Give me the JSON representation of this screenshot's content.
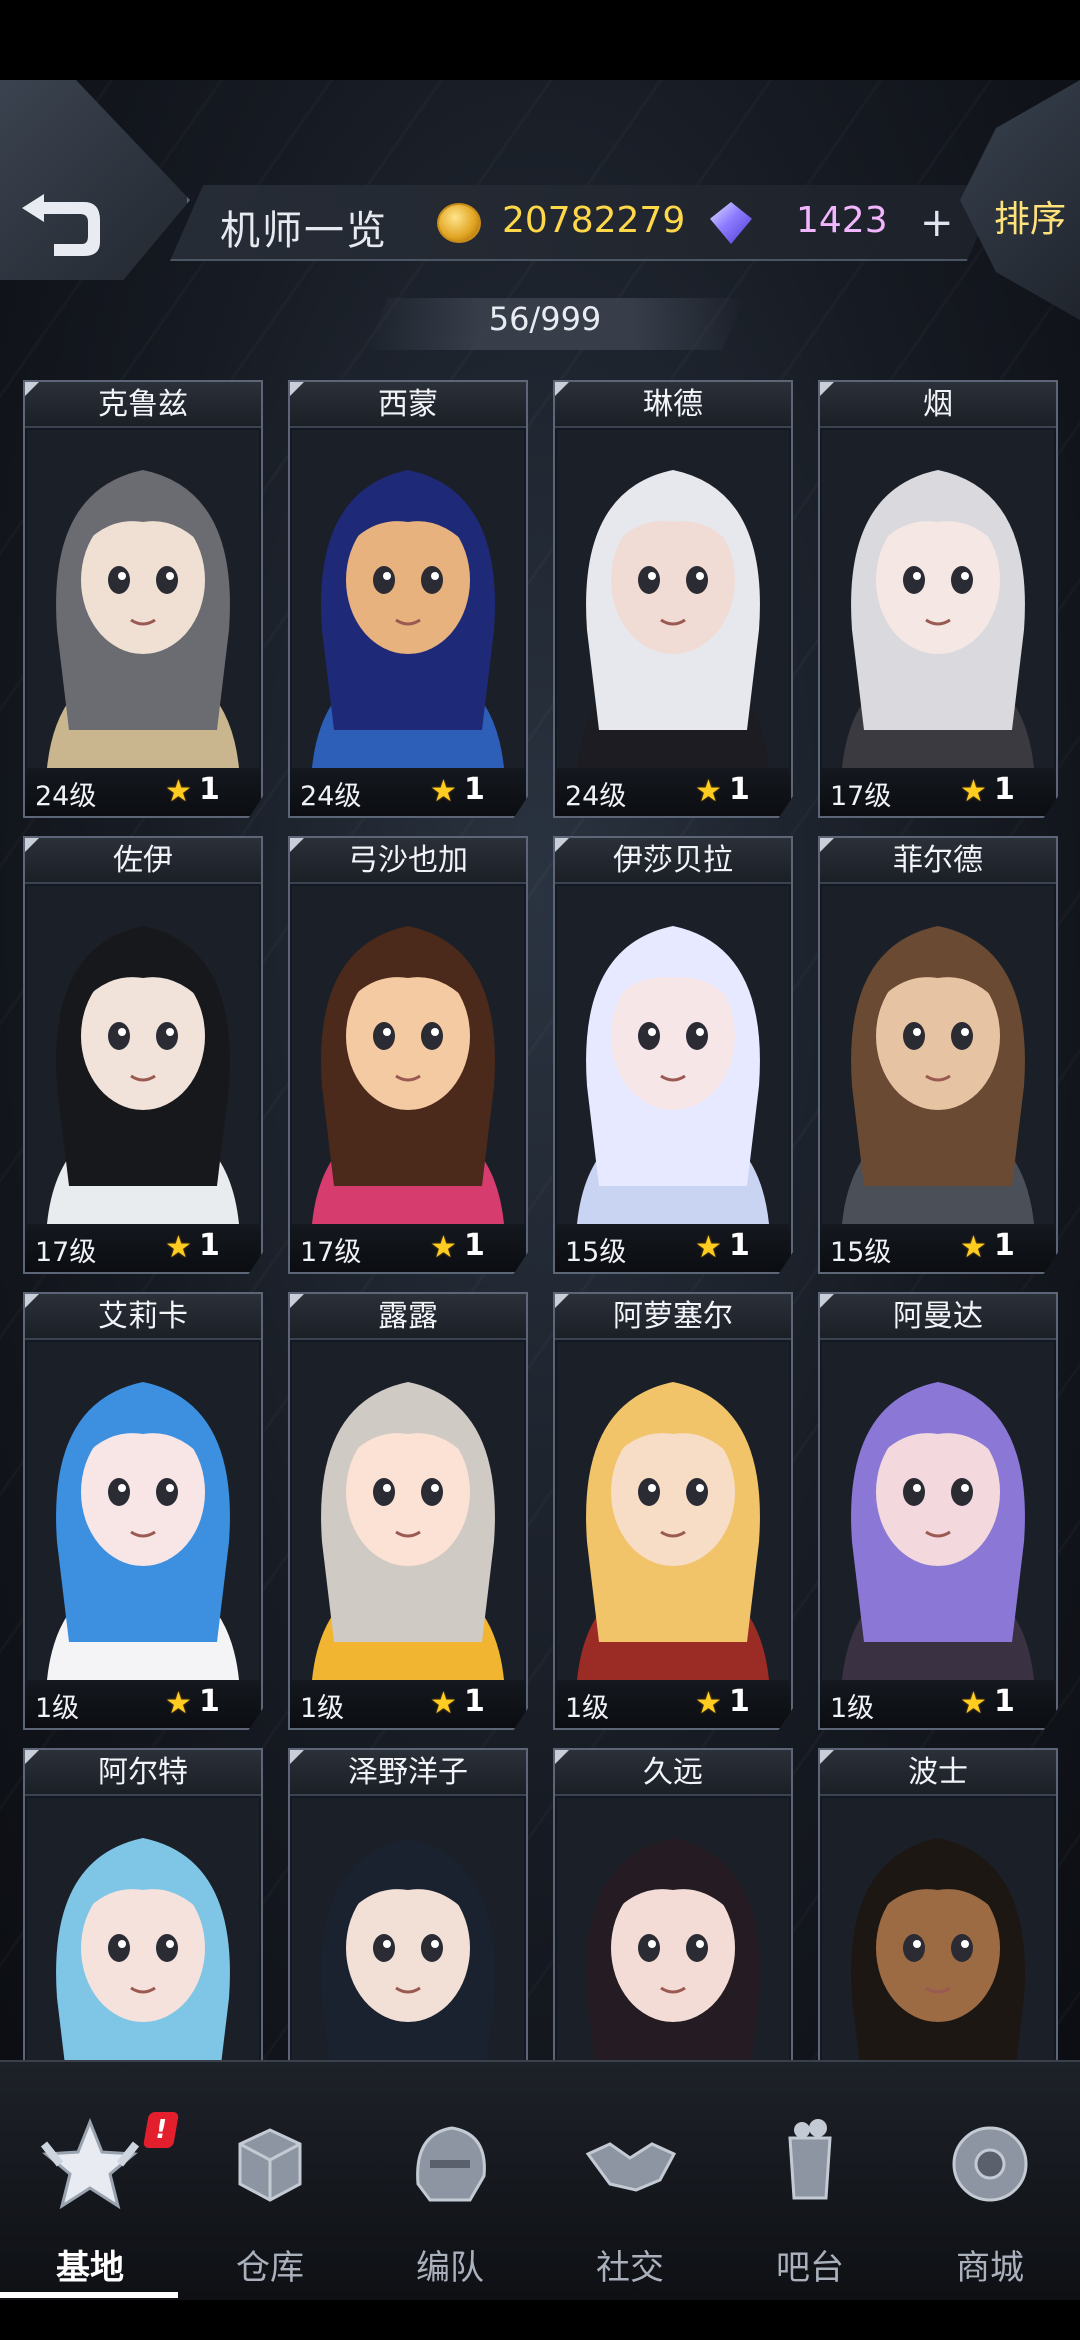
{
  "header": {
    "title": "机师一览",
    "coins": "20782279",
    "gems": "1423",
    "plus_label": "+",
    "sort_label": "排序",
    "count": "56/999"
  },
  "colors": {
    "gold": "#ffd84a",
    "gem": "#f2b6ff",
    "star": "#ffcc22",
    "badge": "#e31f2d"
  },
  "pilots": [
    {
      "name": "克鲁兹",
      "level": "24级",
      "stars": "1",
      "palette": [
        "#6b6b72",
        "#efe0d3",
        "#c9b68e"
      ]
    },
    {
      "name": "西蒙",
      "level": "24级",
      "stars": "1",
      "palette": [
        "#1e2a78",
        "#e8b27e",
        "#2e5fb8"
      ]
    },
    {
      "name": "琳德",
      "level": "24级",
      "stars": "1",
      "palette": [
        "#e7e7ee",
        "#f1dcd5",
        "#1c1c22"
      ]
    },
    {
      "name": "烟",
      "level": "17级",
      "stars": "1",
      "palette": [
        "#d9d9de",
        "#f4e7e4",
        "#3a3a40"
      ]
    },
    {
      "name": "佐伊",
      "level": "17级",
      "stars": "1",
      "palette": [
        "#17181c",
        "#f1e2da",
        "#e9ecef"
      ]
    },
    {
      "name": "弓沙也加",
      "level": "17级",
      "stars": "1",
      "palette": [
        "#4b2a1c",
        "#f3caa2",
        "#d63d6e"
      ]
    },
    {
      "name": "伊莎贝拉",
      "level": "15级",
      "stars": "1",
      "palette": [
        "#e6e9ff",
        "#f6e6e8",
        "#c9d4f2"
      ]
    },
    {
      "name": "菲尔德",
      "level": "15级",
      "stars": "1",
      "palette": [
        "#6a4a32",
        "#e6c3a3",
        "#4b5058"
      ]
    },
    {
      "name": "艾莉卡",
      "level": "1级",
      "stars": "1",
      "palette": [
        "#3d8fe0",
        "#f8e6e6",
        "#f4f4f6"
      ]
    },
    {
      "name": "露露",
      "level": "1级",
      "stars": "1",
      "palette": [
        "#cfcac4",
        "#fbe2d4",
        "#f1b531"
      ]
    },
    {
      "name": "阿萝塞尔",
      "level": "1级",
      "stars": "1",
      "palette": [
        "#f1c46a",
        "#f7dcc6",
        "#9a2b25"
      ]
    },
    {
      "name": "阿曼达",
      "level": "1级",
      "stars": "1",
      "palette": [
        "#8b78d6",
        "#f3d9dd",
        "#3a3142"
      ]
    },
    {
      "name": "阿尔特",
      "level": "",
      "stars": "",
      "palette": [
        "#7fc6e6",
        "#f5e2dc",
        "#3e4248"
      ]
    },
    {
      "name": "泽野洋子",
      "level": "",
      "stars": "",
      "palette": [
        "#1a2230",
        "#f2dfd6",
        "#5a5e66"
      ]
    },
    {
      "name": "久远",
      "level": "",
      "stars": "",
      "palette": [
        "#241c22",
        "#f3dcd6",
        "#b32332"
      ]
    },
    {
      "name": "波士",
      "level": "",
      "stars": "",
      "palette": [
        "#1c1712",
        "#9c6b44",
        "#c43a2a"
      ]
    }
  ],
  "nav": [
    {
      "label": "基地",
      "icon": "base-emblem-icon",
      "active": true
    },
    {
      "label": "仓库",
      "icon": "warehouse-crate-icon",
      "active": false
    },
    {
      "label": "编队",
      "icon": "formation-helmet-icon",
      "active": false
    },
    {
      "label": "社交",
      "icon": "handshake-icon",
      "active": false
    },
    {
      "label": "吧台",
      "icon": "bar-drink-icon",
      "active": false
    },
    {
      "label": "商城",
      "icon": "shop-capsule-icon",
      "active": false
    }
  ],
  "nav_badge": "!"
}
